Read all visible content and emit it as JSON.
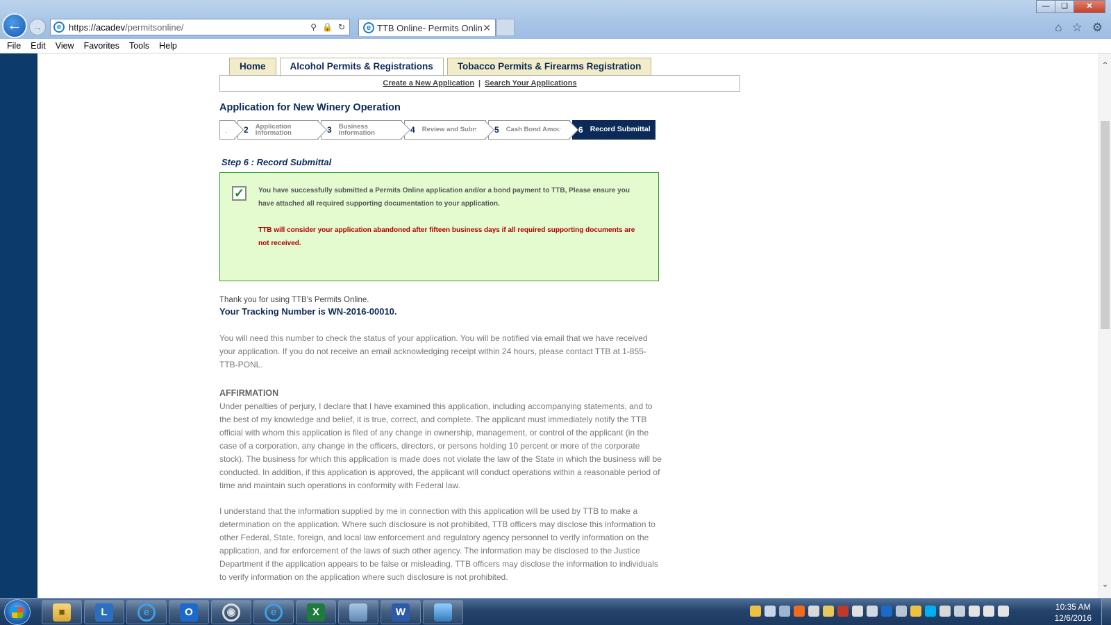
{
  "browser": {
    "url_prefix": "https://",
    "url_host": "acadev",
    "url_path": "/permitsonline/",
    "tab_title": "TTB Online- Permits Online...",
    "menu": [
      "File",
      "Edit",
      "View",
      "Favorites",
      "Tools",
      "Help"
    ]
  },
  "nav": {
    "tabs": [
      {
        "label": "Home"
      },
      {
        "label": "Alcohol Permits & Registrations"
      },
      {
        "label": "Tobacco Permits & Firearms Registration"
      }
    ],
    "active_tab": "Alcohol Permits & Registrations",
    "sub_links": [
      "Create a New Application",
      "Search Your Applications"
    ],
    "sub_separator": "|"
  },
  "page_title": "Application for New Winery Operation",
  "steps": [
    {
      "num": "1",
      "line1": "",
      "line2": ""
    },
    {
      "num": "2",
      "line1": "Application",
      "line2": "Information"
    },
    {
      "num": "3",
      "line1": "Business",
      "line2": "Information"
    },
    {
      "num": "4",
      "line1": "Review and Submit",
      "line2": ""
    },
    {
      "num": "5",
      "line1": "Cash Bond Amount",
      "line2": ""
    },
    {
      "num": "6",
      "line1": "Record Submittal",
      "line2": ""
    }
  ],
  "active_step": 6,
  "step_heading": "Step 6 : Record Submittal",
  "success": {
    "message": "You have successfully submitted a Permits Online application and/or a bond payment to TTB, Please ensure you have attached all required supporting documentation to your application.",
    "warning": "TTB will consider your application abandoned after fifteen business days if all required supporting documents are not received."
  },
  "thank_you": "Thank you for using TTB's Permits Online.",
  "tracking": "Your Tracking Number is WN-2016-00010.",
  "notice": "You will need this number to check the status of your application. You will be notified via email that we have received your application.  If you do not receive an email acknowledging receipt within 24 hours, please contact TTB at 1-855-TTB-PONL.",
  "affirmation": {
    "heading": "AFFIRMATION",
    "p1": "Under penalties of perjury, I declare that I have examined this application, including accompanying statements, and to the best of my knowledge and belief, it is true, correct, and complete. The applicant must immediately notify the TTB official with whom this application is filed of any change in ownership, management, or control of the applicant (in the case of a corporation, any change in the officers, directors, or persons holding 10 percent or more of the corporate stock). The business for which this application is made does not violate the law of the State in which the business will be conducted. In addition, if this application is approved, the applicant will conduct operations within a reasonable period of time and maintain such operations in conformity with Federal law.",
    "p2": "I understand that the information supplied by me in connection with this application will be used by TTB to make a determination on the application. Where such disclosure is not prohibited, TTB officers may disclose this information to other Federal, State, foreign, and local law enforcement and regulatory agency personnel to verify information on the application, and for enforcement of the laws of such other agency. The information may be disclosed to the Justice Department if the application appears to be false or misleading. TTB officers may disclose the information to individuals to verify information on the application where such disclosure is not prohibited."
  },
  "taskbar": {
    "time": "10:35 AM",
    "date": "12/6/2016",
    "apps": [
      "file-explorer",
      "lync",
      "internet-explorer",
      "outlook",
      "chrome",
      "internet-explorer",
      "excel",
      "tablet",
      "word",
      "picture-viewer"
    ]
  },
  "colors": {
    "navy": "#0c2a58",
    "success_bg": "#e4fbcf",
    "success_border": "#2e9a2e",
    "warning_red": "#b00000",
    "left_band": "#0c3b6b"
  }
}
